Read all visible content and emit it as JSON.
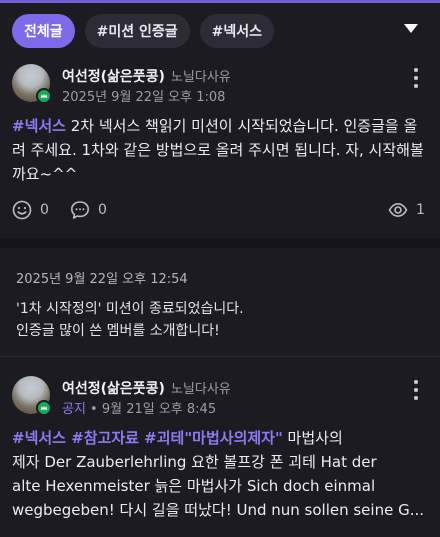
{
  "filters": [
    {
      "label": "전체글",
      "active": true
    },
    {
      "label": "#미션 인증글",
      "active": false
    },
    {
      "label": "#넥서스",
      "active": false
    }
  ],
  "post1": {
    "author": "여선정(삶은풋콩)",
    "role": "노닐다사유",
    "date": "2025년 9월 22일 오후 1:08",
    "tag": "#넥서스",
    "text": " 2차 넥서스 책읽기 미션이 시작되었습니다. 인증글을 올려 주세요. 1차와 같은 방법으로 올려 주시면 됩니다. 자, 시작해볼까요~^^",
    "likes": "0",
    "comments": "0",
    "views": "1"
  },
  "system": {
    "time": "2025년 9월 22일 오후 12:54",
    "line1": "'1차 시작정의' 미션이 종료되었습니다.",
    "line2": "인증글 많이 쓴 멤버를 소개합니다!"
  },
  "post2": {
    "author": "여선정(삶은풋콩)",
    "role": "노닐다사유",
    "notice": "공지",
    "date": " • 9월 21일 오후 8:45",
    "tags": "#넥서스 #참고자료  #괴테\"마법사의제자\"",
    "text1": " 마법사의",
    "text2": "제자 Der Zauberlehrling 요한 볼프강 폰 괴테 Hat der",
    "text3": "alte Hexenmeister 늙은 마법사가 Sich doch einmal",
    "text4": "wegbegeben! 다시 길을 떠났다! Und nun sollen seine G..."
  }
}
